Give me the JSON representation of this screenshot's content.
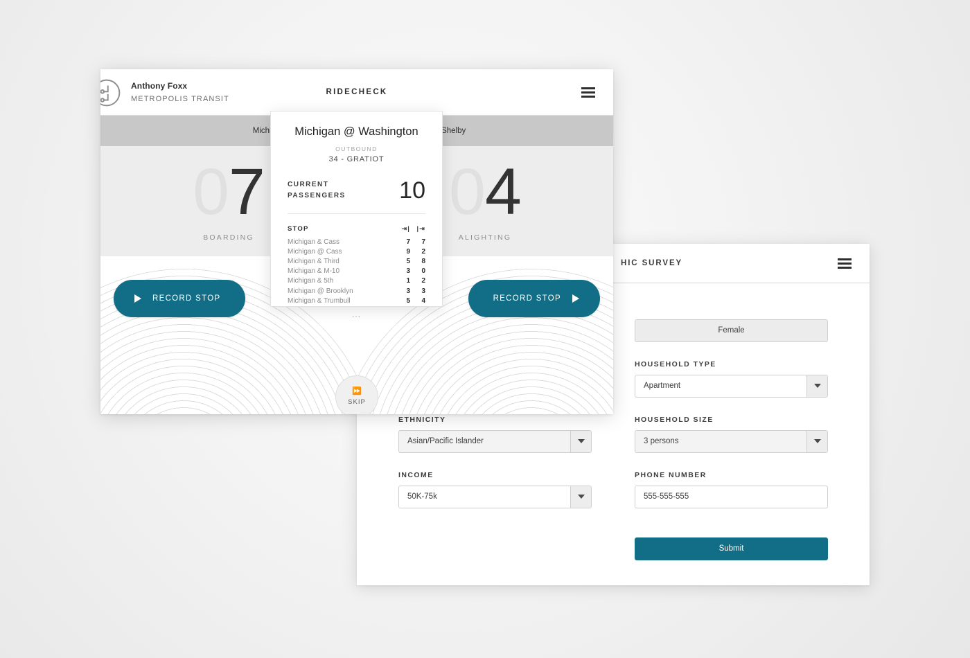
{
  "brand_color": "#126e86",
  "ride_app": {
    "header": {
      "user_name": "Anthony Foxx",
      "organization": "METROPOLIS TRANSIT",
      "brand": "RIDECHECK",
      "logo_icon": "transit-logo-icon",
      "menu_icon": "hamburger-menu-icon"
    },
    "stop_bar": {
      "prev_stop": "Michigan & Cass",
      "next_stop": "Michigan & Shelby"
    },
    "counters": [
      {
        "zero": "0",
        "value": "7",
        "label": "BOARDING"
      },
      {
        "zero": "0",
        "value": "4",
        "label": "ALIGHTING"
      }
    ],
    "actions": {
      "record_left": "RECORD STOP",
      "record_right": "RECORD STOP",
      "play_icon": "play-triangle-icon",
      "skip_label": "SKIP",
      "skip_icon": "skip-forward-icon"
    }
  },
  "stop_card": {
    "title": "Michigan @ Washington",
    "direction": "OUTBOUND",
    "route": "34 - GRATIOT",
    "current_passengers_label": "CURRENT PASSENGERS",
    "current_passengers_value": "10",
    "table": {
      "headers": [
        "STOP",
        "boarding-arrow-icon",
        "alighting-arrow-icon"
      ],
      "rows": [
        {
          "stop": "Michigan & Cass",
          "on": "7",
          "off": "7"
        },
        {
          "stop": "Michigan @ Cass",
          "on": "9",
          "off": "2"
        },
        {
          "stop": "Michigan & Third",
          "on": "5",
          "off": "8"
        },
        {
          "stop": "Michigan & M-10",
          "on": "3",
          "off": "0"
        },
        {
          "stop": "Michigan & 5th",
          "on": "1",
          "off": "2"
        },
        {
          "stop": "Michigan @ Brooklyn",
          "on": "3",
          "off": "3"
        },
        {
          "stop": "Michigan & Trumbull",
          "on": "5",
          "off": "4"
        }
      ],
      "more_indicator": "..."
    }
  },
  "survey": {
    "title": "HIC SURVEY",
    "menu_icon": "hamburger-menu-icon",
    "fields": {
      "gender_value": "Female",
      "household_type_label": "HOUSEHOLD TYPE",
      "household_type_value": "Apartment",
      "ethnicity_label": "ETHNICITY",
      "ethnicity_value": "Asian/Pacific Islander",
      "household_size_label": "HOUSEHOLD SIZE",
      "household_size_value": "3 persons",
      "income_label": "INCOME",
      "income_value": "50K-75k",
      "phone_label": "PHONE NUMBER",
      "phone_value": "555-555-555",
      "submit_label": "Submit"
    }
  }
}
